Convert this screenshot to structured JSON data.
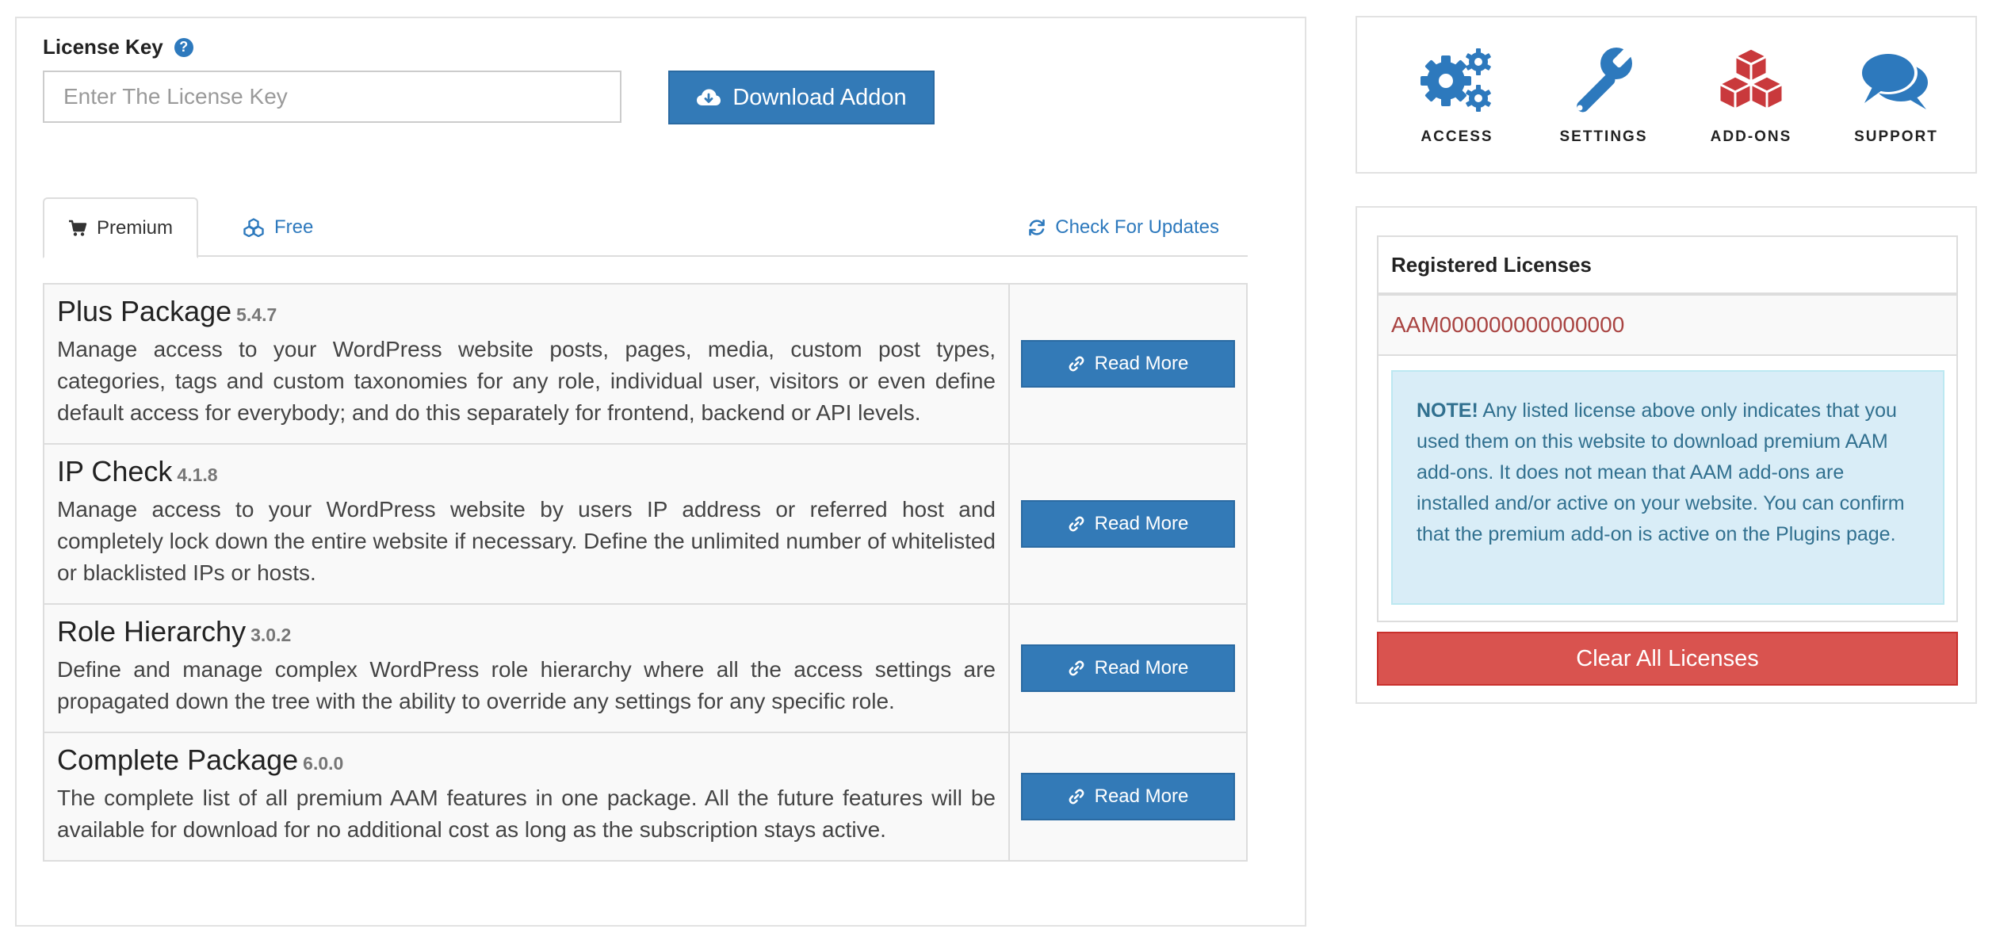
{
  "license": {
    "label": "License Key",
    "placeholder": "Enter The License Key",
    "download_label": "Download Addon"
  },
  "tabs": {
    "premium": "Premium",
    "free": "Free",
    "check_updates": "Check For Updates"
  },
  "addons": [
    {
      "title": "Plus Package",
      "version": "5.4.7",
      "description": "Manage access to your WordPress website posts, pages, media, custom post types, categories, tags and custom taxonomies for any role, individual user, visitors or even define default access for everybody; and do this separately for frontend, backend or API levels.",
      "button": "Read More"
    },
    {
      "title": "IP Check",
      "version": "4.1.8",
      "description": "Manage access to your WordPress website by users IP address or referred host and completely lock down the entire website if necessary. Define the unlimited number of whitelisted or blacklisted IPs or hosts.",
      "button": "Read More"
    },
    {
      "title": "Role Hierarchy",
      "version": "3.0.2",
      "description": "Define and manage complex WordPress role hierarchy where all the access settings are propagated down the tree with the ability to override any settings for any specific role.",
      "button": "Read More"
    },
    {
      "title": "Complete Package",
      "version": "6.0.0",
      "description": "The complete list of all premium AAM features in one package. All the future features will be available for download for no additional cost as long as the subscription stays active.",
      "button": "Read More"
    }
  ],
  "nav": {
    "access": "ACCESS",
    "settings": "SETTINGS",
    "addons": "ADD-ONS",
    "support": "SUPPORT"
  },
  "licenses": {
    "header": "Registered Licenses",
    "items": [
      "AAM000000000000000"
    ],
    "note_strong": "NOTE!",
    "note_text": " Any listed license above only indicates that you used them on this website to download premium AAM add-ons. It does not mean that AAM add-ons are installed and/or active on your website. You can confirm that the premium add-on is active on the Plugins page.",
    "clear_label": "Clear All Licenses"
  },
  "colors": {
    "primary": "#337ab7",
    "icon_blue": "#2d79bd",
    "addon_red": "#c9393c",
    "danger": "#d9534f",
    "note_bg": "#d9edf7",
    "note_text": "#31708f",
    "license_text": "#a94442"
  }
}
